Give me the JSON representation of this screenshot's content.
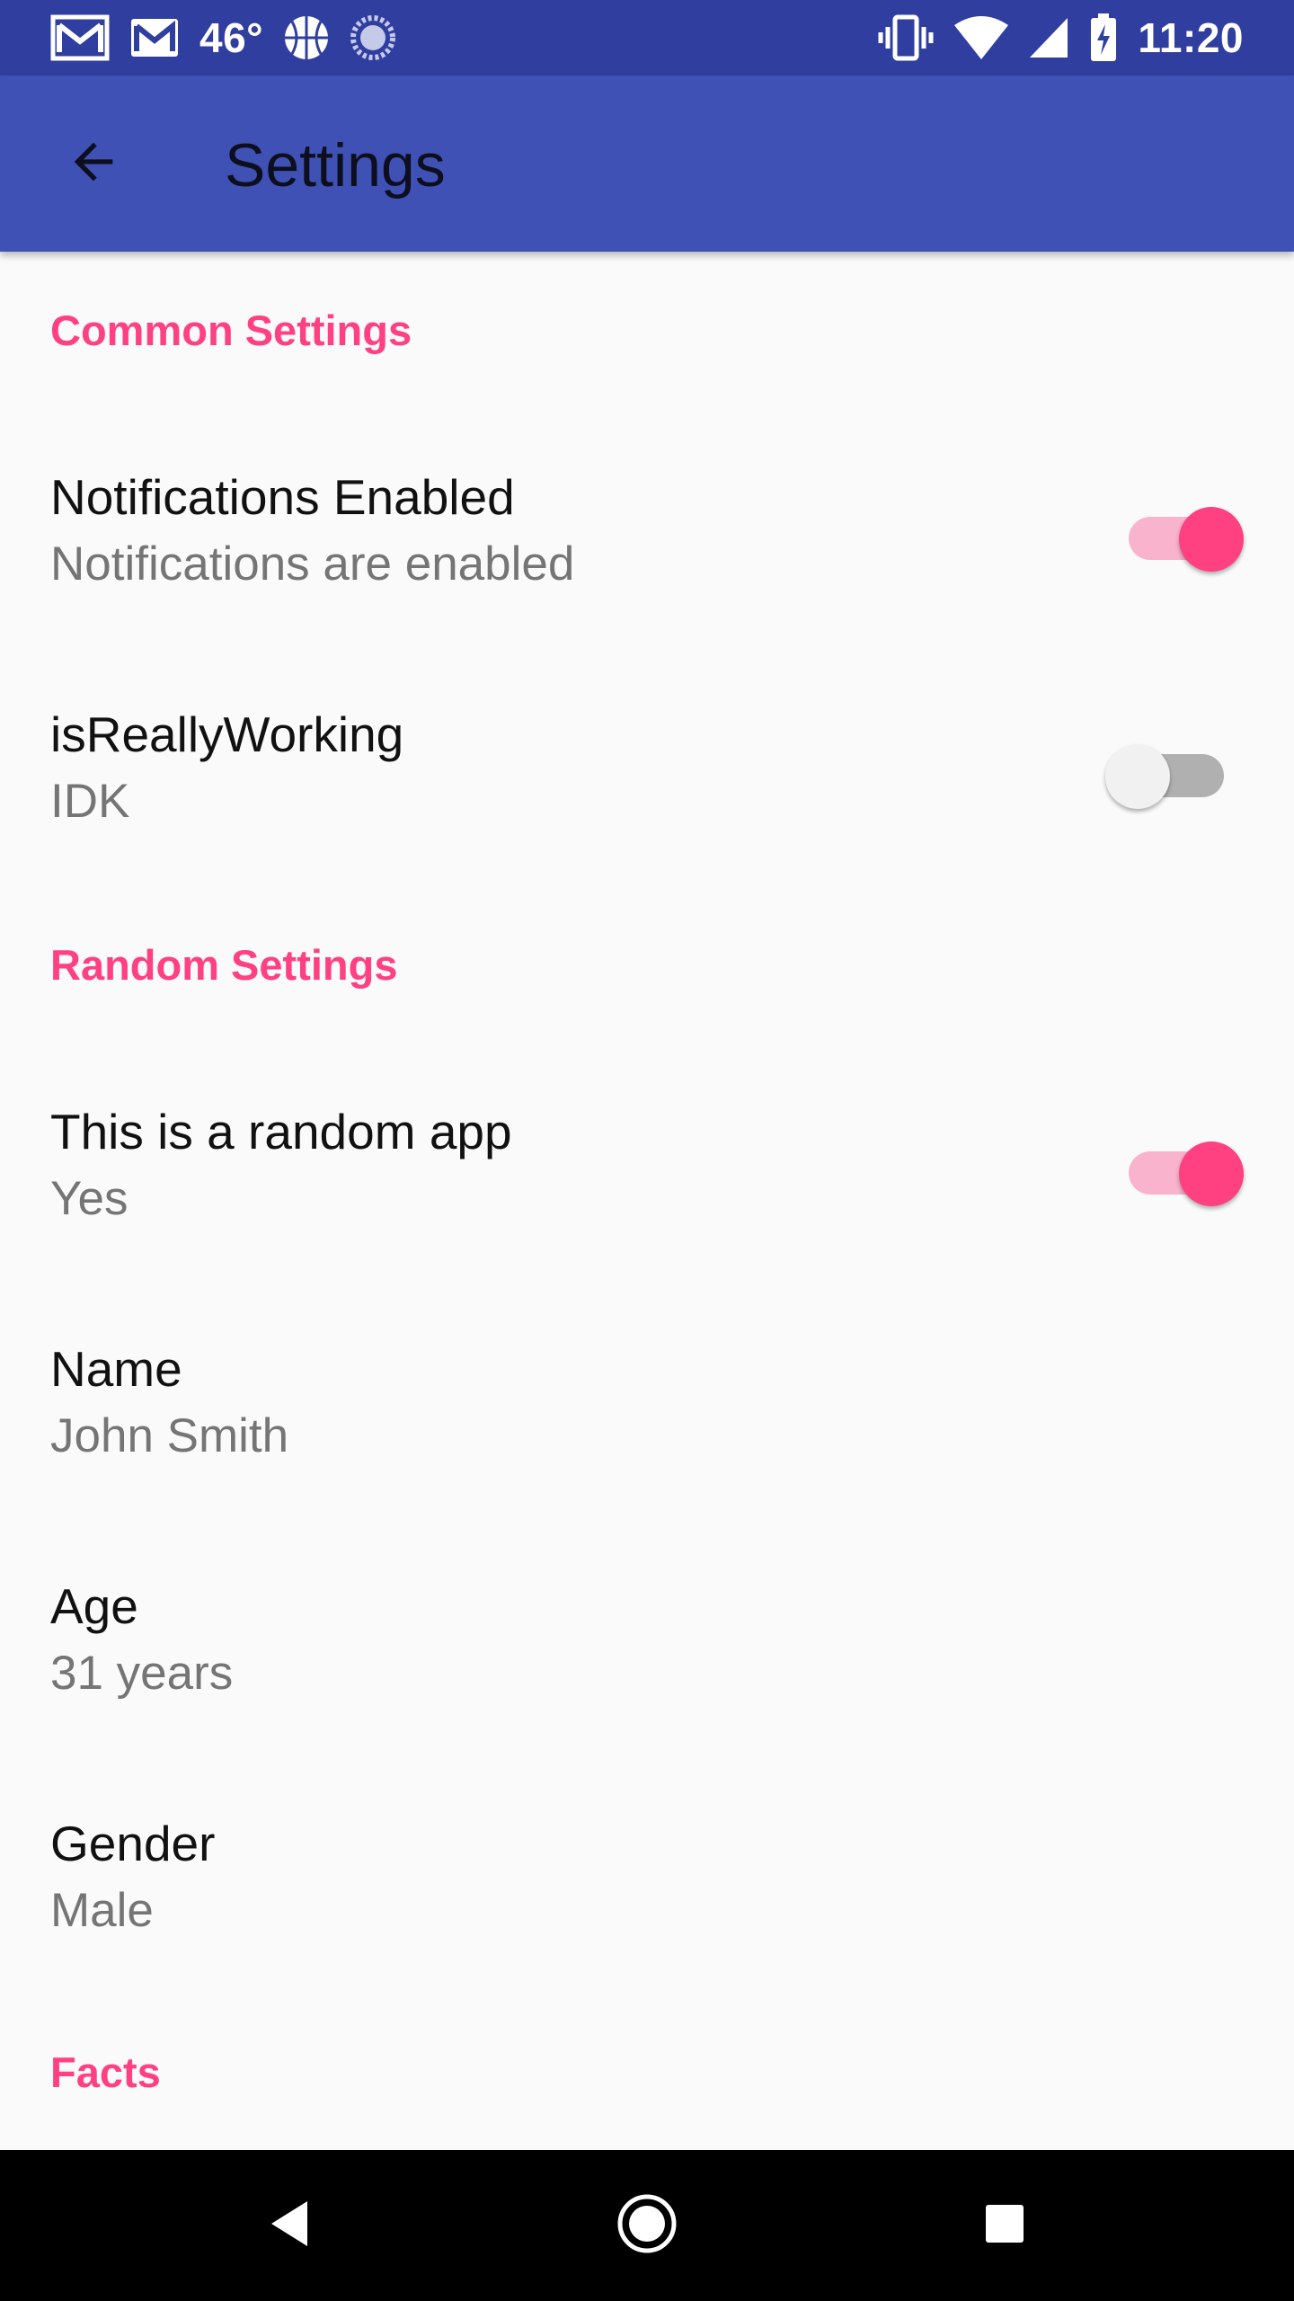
{
  "status_bar": {
    "temperature": "46°",
    "time": "11:20",
    "left_icons": [
      "gmail-icon",
      "email-icon",
      "basketball-icon",
      "sync-icon"
    ],
    "right_icons": [
      "vibrate-icon",
      "wifi-icon",
      "signal-icon",
      "battery-charging-icon"
    ]
  },
  "app_bar": {
    "title": "Settings",
    "back_icon": "arrow-back-icon"
  },
  "categories": {
    "common": "Common Settings",
    "random": "Random Settings",
    "facts": "Facts"
  },
  "preferences": {
    "notifications": {
      "title": "Notifications Enabled",
      "summary": "Notifications are enabled",
      "checked": true
    },
    "working": {
      "title": "isReallyWorking",
      "summary": "IDK",
      "checked": false
    },
    "random_app": {
      "title": "This is a random app",
      "summary": "Yes",
      "checked": true
    },
    "name": {
      "title": "Name",
      "summary": "John Smith"
    },
    "age": {
      "title": "Age",
      "summary": "31 years"
    },
    "gender": {
      "title": "Gender",
      "summary": "Male"
    }
  },
  "nav_bar": {
    "back_icon": "nav-back-icon",
    "home_icon": "nav-home-icon",
    "recents_icon": "nav-recents-icon"
  },
  "colors": {
    "status_bar": "#303f9f",
    "app_bar": "#3f51b5",
    "accent": "#ff4081",
    "background": "#fafafa",
    "summary_text": "#757575"
  }
}
